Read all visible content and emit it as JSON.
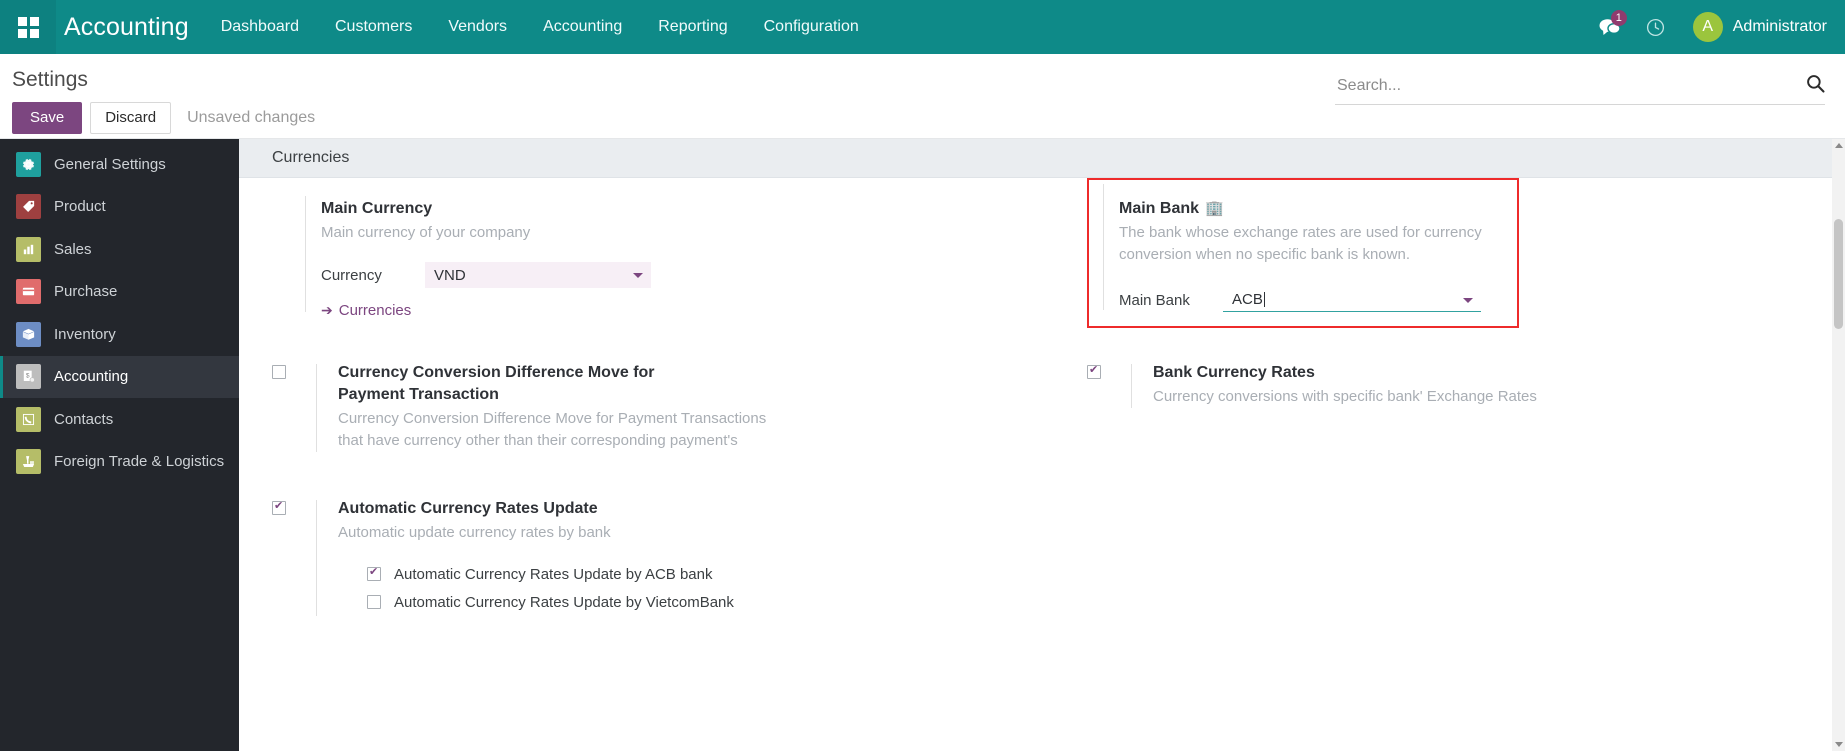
{
  "navbar": {
    "apps_icon": "apps-grid-icon",
    "brand": "Accounting",
    "menu": [
      {
        "label": "Dashboard"
      },
      {
        "label": "Customers"
      },
      {
        "label": "Vendors"
      },
      {
        "label": "Accounting"
      },
      {
        "label": "Reporting"
      },
      {
        "label": "Configuration"
      }
    ],
    "messages_icon": "messages-icon",
    "messages_badge": "1",
    "activity_icon": "clock-icon",
    "avatar_initial": "A",
    "user_name": "Administrator",
    "bg_color": "#0e8a88"
  },
  "control_panel": {
    "title": "Settings",
    "save_label": "Save",
    "discard_label": "Discard",
    "status_text": "Unsaved changes",
    "search_placeholder": "Search...",
    "search_value": "",
    "search_icon": "search-icon",
    "save_color": "#7c4680"
  },
  "sidebar": {
    "items": [
      {
        "label": "General Settings",
        "icon": "gear-icon",
        "color": "#1fa09e",
        "active": false
      },
      {
        "label": "Product",
        "icon": "tag-icon",
        "color": "#9e4040",
        "active": false
      },
      {
        "label": "Sales",
        "icon": "bar-chart-icon",
        "color": "#b5bd68",
        "active": false
      },
      {
        "label": "Purchase",
        "icon": "credit-card-icon",
        "color": "#e06c6c",
        "active": false
      },
      {
        "label": "Inventory",
        "icon": "box-icon",
        "color": "#6d8dc4",
        "active": false
      },
      {
        "label": "Accounting",
        "icon": "invoice-icon",
        "color": "#bdbdbd",
        "active": true
      },
      {
        "label": "Contacts",
        "icon": "phone-icon",
        "color": "#b5bd68",
        "active": false
      },
      {
        "label": "Foreign Trade & Logistics",
        "icon": "ship-icon",
        "color": "#b5bd68",
        "active": false
      }
    ],
    "bg_color": "#23262c",
    "active_accent": "#0e8a88"
  },
  "main": {
    "section_title": "Currencies",
    "main_currency": {
      "title": "Main Currency",
      "description": "Main currency of your company",
      "field_label": "Currency",
      "field_value": "VND",
      "caret_icon": "chevron-down-icon",
      "link_label": "Currencies",
      "link_icon": "arrow-right-icon"
    },
    "main_bank": {
      "title": "Main Bank",
      "title_icon": "🏢",
      "description": "The bank whose exchange rates are used for currency conversion when no specific bank is known.",
      "field_label": "Main Bank",
      "field_value": "ACB",
      "caret_icon": "chevron-down-icon",
      "highlight_color": "#ee2b2b",
      "focus_underline_color": "#31a2a0"
    },
    "settings": [
      {
        "title": "Currency Conversion Difference Move for Payment Transaction",
        "description": "Currency Conversion Difference Move for Payment Transactions that have currency other than their corresponding payment's",
        "checked": false
      },
      {
        "title": "Bank Currency Rates",
        "description": "Currency conversions with specific bank' Exchange Rates",
        "checked": true
      }
    ],
    "auto_update": {
      "title": "Automatic Currency Rates Update",
      "description": "Automatic update currency rates by bank",
      "checked": true,
      "sub_items": [
        {
          "label": "Automatic Currency Rates Update by ACB bank",
          "checked": true
        },
        {
          "label": "Automatic Currency Rates Update by VietcomBank",
          "checked": false
        }
      ]
    }
  }
}
